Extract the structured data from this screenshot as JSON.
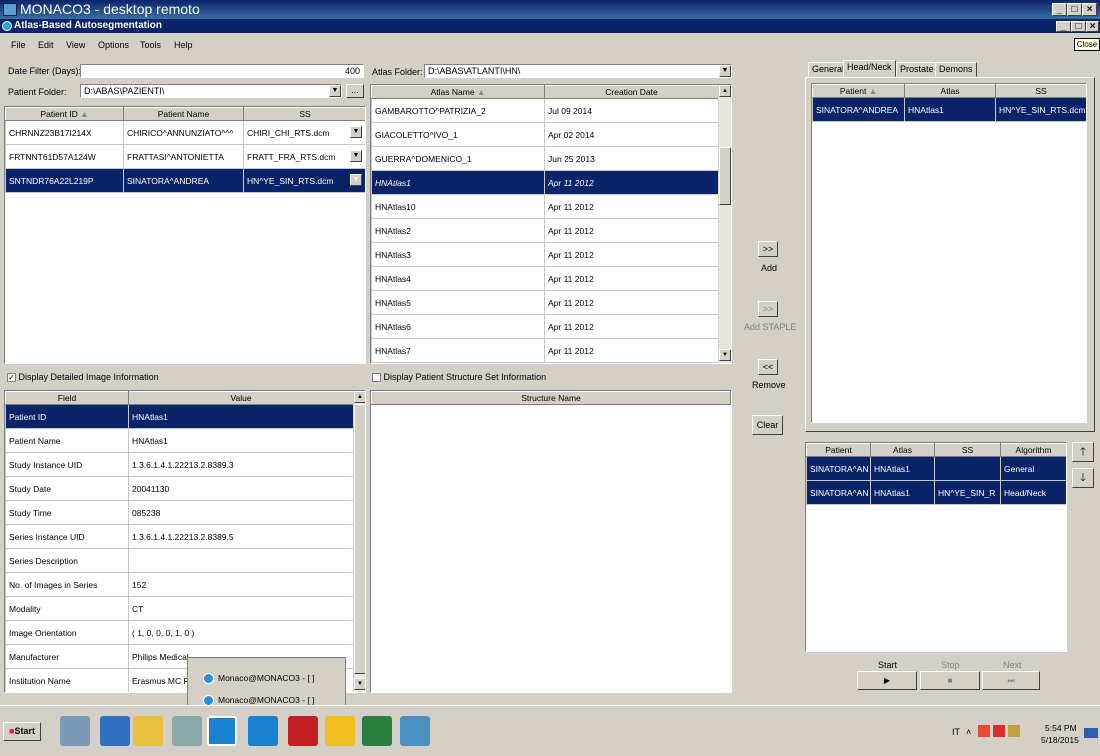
{
  "window": {
    "rdp_title": "MONACO3 - desktop remoto",
    "app_title": "Atlas-Based Autosegmentation",
    "close_tooltip": "Close"
  },
  "menu": [
    "File",
    "Edit",
    "View",
    "Options",
    "Tools",
    "Help"
  ],
  "filters": {
    "date_filter_label": "Date Filter (Days):",
    "date_filter_value": "400",
    "patient_folder_label": "Patient Folder:",
    "patient_folder_value": "D:\\ABAS\\PAZIENTI\\",
    "browse": "...",
    "atlas_folder_label": "Atlas Folder:",
    "atlas_folder_value": "D:\\ABAS\\ATLANTI\\HN\\"
  },
  "patients": {
    "columns": [
      "Patient ID",
      "Patient Name",
      "SS"
    ],
    "rows": [
      {
        "id": "CHRNNZ23B17I214X",
        "name": "CHIRICO^ANNUNZIATO^^^",
        "ss": "CHIRI_CHI_RTS.dcm"
      },
      {
        "id": "FRTNNT61D57A124W",
        "name": "FRATTASI^ANTONIETTA",
        "ss": "FRATT_FRA_RTS.dcm"
      },
      {
        "id": "SNTNDR76A22L219P",
        "name": "SINATORA^ANDREA",
        "ss": "HN^YE_SIN_RTS.dcm"
      }
    ],
    "selected_index": 2
  },
  "atlases": {
    "columns": [
      "Atlas Name",
      "Creation Date"
    ],
    "rows": [
      {
        "name": "GAMBAROTTO^PATRIZIA_2",
        "date": "Jul 09 2014"
      },
      {
        "name": "GIACOLETTO^IVO_1",
        "date": "Apr 02 2014"
      },
      {
        "name": "GUERRA^DOMENICO_1",
        "date": "Jun 25 2013"
      },
      {
        "name": "HNAtlas1",
        "date": "Apr 11 2012"
      },
      {
        "name": "HNAtlas10",
        "date": "Apr 11 2012"
      },
      {
        "name": "HNAtlas2",
        "date": "Apr 11 2012"
      },
      {
        "name": "HNAtlas3",
        "date": "Apr 11 2012"
      },
      {
        "name": "HNAtlas4",
        "date": "Apr 11 2012"
      },
      {
        "name": "HNAtlas5",
        "date": "Apr 11 2012"
      },
      {
        "name": "HNAtlas6",
        "date": "Apr 11 2012"
      },
      {
        "name": "HNAtlas7",
        "date": "Apr 11 2012"
      }
    ],
    "selected_index": 3
  },
  "actions": {
    "add_arrow": ">>",
    "add": "Add",
    "add_staple_arrow": ">>",
    "add_staple": "Add STAPLE",
    "remove_arrow": "<<",
    "remove": "Remove",
    "clear": "Clear"
  },
  "display_detail": {
    "label": "Display Detailed Image Information",
    "checked": "✓"
  },
  "display_structure": {
    "label": "Display Patient Structure Set Information"
  },
  "details": {
    "columns": [
      "Field",
      "Value"
    ],
    "rows": [
      {
        "field": "Patient ID",
        "value": "HNAtlas1"
      },
      {
        "field": "Patient Name",
        "value": "HNAtlas1"
      },
      {
        "field": "Study Instance UID",
        "value": "1.3.6.1.4.1.22213.2.8389.3"
      },
      {
        "field": "Study Date",
        "value": "20041130"
      },
      {
        "field": "Study Time",
        "value": "085238"
      },
      {
        "field": "Series Instance UID",
        "value": "1.3.6.1.4.1.22213.2.8389.5"
      },
      {
        "field": "Series Description",
        "value": ""
      },
      {
        "field": "No. of Images in Series",
        "value": "152"
      },
      {
        "field": "Modality",
        "value": "CT"
      },
      {
        "field": "Image Orientation",
        "value": "( 1, 0, 0, 0, 1, 0 )"
      },
      {
        "field": "Manufacturer",
        "value": "Philips Medical"
      },
      {
        "field": "Institution Name",
        "value": "Erasmus MC R"
      }
    ],
    "selected_index": 0
  },
  "structures": {
    "columns": [
      "Structure Name"
    ]
  },
  "tabs": [
    "General",
    "Head/Neck",
    "Prostate",
    "Demons"
  ],
  "active_tab": "Head/Neck",
  "headneck": {
    "columns": [
      "Patient",
      "Atlas",
      "SS"
    ],
    "rows": [
      {
        "patient": "SINATORA^ANDREA",
        "atlas": "HNAtlas1",
        "ss": "HN^YE_SIN_RTS.dcm"
      }
    ]
  },
  "queue": {
    "columns": [
      "Patient",
      "Atlas",
      "SS",
      "Algorithm"
    ],
    "rows": [
      {
        "patient": "SINATORA^AN",
        "atlas": "HNAtlas1",
        "ss": "",
        "algorithm": "General"
      },
      {
        "patient": "SINATORA^AN",
        "atlas": "HNAtlas1",
        "ss": "HN^YE_SIN_R",
        "algorithm": "Head/Neck"
      }
    ]
  },
  "controls": {
    "start": "Start",
    "stop": "Stop",
    "next": "Next",
    "start_icon": "▶",
    "stop_icon": "■",
    "next_icon": "⏭"
  },
  "popup": [
    "Monaco@MONACO3 - [ ]",
    "Monaco@MONACO3 - [ ]"
  ],
  "taskbar": {
    "start": "Start",
    "lang": "IT",
    "time": "5:54 PM",
    "date": "5/18/2015"
  }
}
